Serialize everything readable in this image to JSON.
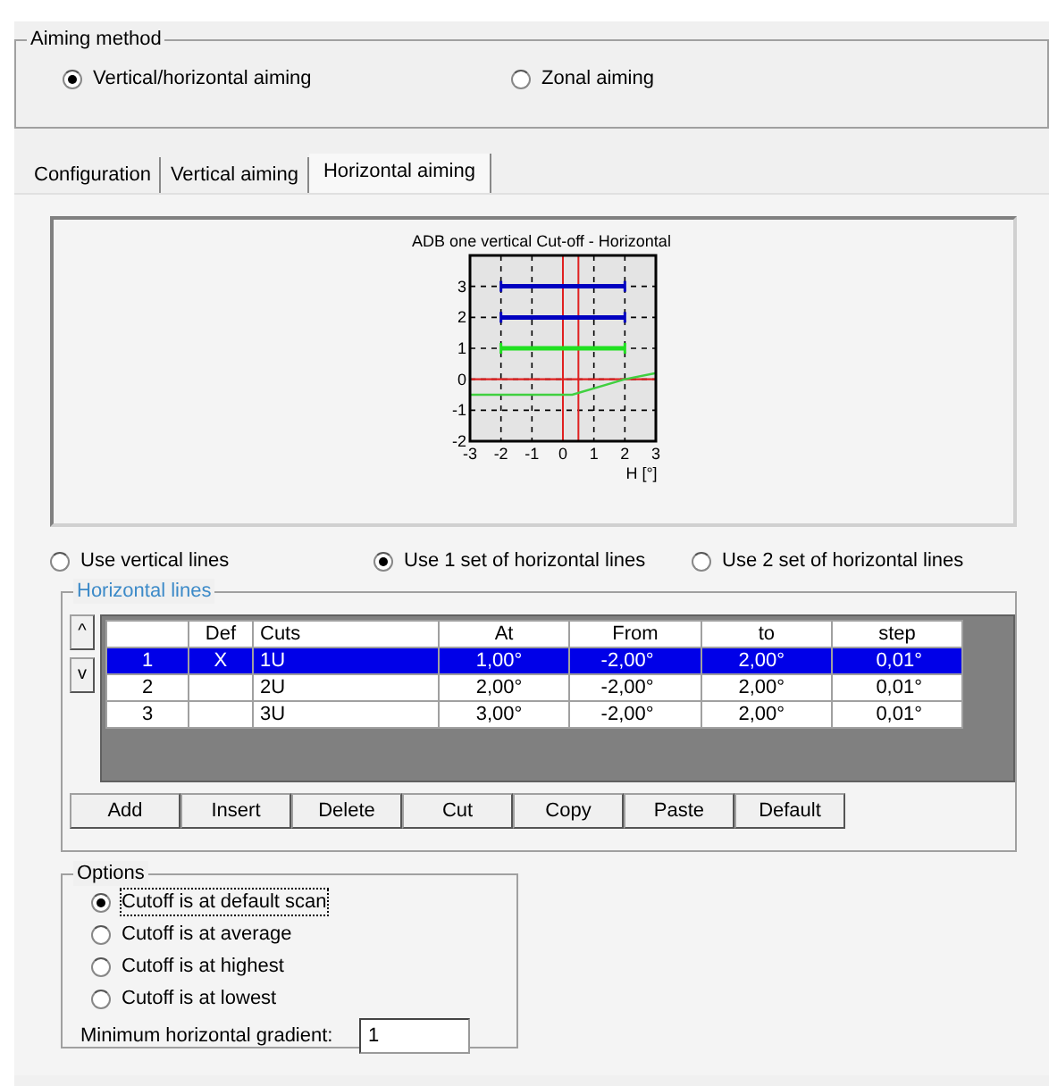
{
  "aiming_method": {
    "title": "Aiming method",
    "options": [
      {
        "label": "Vertical/horizontal aiming",
        "selected": true
      },
      {
        "label": "Zonal aiming",
        "selected": false
      }
    ]
  },
  "tabs": [
    {
      "label": "Configuration",
      "selected": false
    },
    {
      "label": "Vertical aiming",
      "selected": false
    },
    {
      "label": "Horizontal aiming",
      "selected": true
    }
  ],
  "chart": {
    "chart_data": {
      "type": "line",
      "title": "ADB one vertical Cut-off - Horizontal",
      "xlabel": "H [°]",
      "xlim": [
        -3,
        3
      ],
      "ylim": [
        -2,
        4
      ],
      "xticks": [
        -3,
        -2,
        -1,
        0,
        1,
        2,
        3
      ],
      "yticks": [
        -2,
        -1,
        0,
        1,
        2,
        3
      ],
      "x": [
        -3,
        -2,
        0.3,
        2,
        3
      ],
      "series": [
        {
          "color": "#0000c0",
          "values": [
            null,
            3,
            3,
            3,
            null
          ]
        },
        {
          "color": "#0000c0",
          "values": [
            null,
            2,
            2,
            2,
            null
          ]
        },
        {
          "color": "#20e020",
          "values": [
            null,
            1,
            1,
            1,
            null
          ]
        },
        {
          "color": "#e02020",
          "values": [
            0,
            0,
            0,
            0,
            0
          ]
        },
        {
          "color": "#40d040",
          "values": [
            -0.5,
            -0.5,
            -0.5,
            0,
            0.2
          ]
        }
      ],
      "grid": true,
      "ref_lines": [
        {
          "axis": "x",
          "value": 0,
          "color": "#e02020"
        },
        {
          "axis": "x",
          "value": 0.5,
          "color": "#e02020"
        }
      ]
    }
  },
  "line_mode": [
    {
      "label": "Use vertical lines",
      "selected": false
    },
    {
      "label": "Use 1 set of horizontal lines",
      "selected": true
    },
    {
      "label": "Use 2 set of horizontal lines",
      "selected": false
    }
  ],
  "horizontal_lines": {
    "title": "Horizontal lines",
    "scroll_buttons": [
      "^",
      "v"
    ],
    "columns": [
      "Def",
      "Cuts",
      "At",
      "From",
      "to",
      "step"
    ],
    "rows": [
      {
        "number": "1",
        "def": "X",
        "cuts": "1U",
        "at": "1,00°",
        "from": "-2,00°",
        "to": "2,00°",
        "step": "0,01°",
        "selected": true
      },
      {
        "number": "2",
        "cuts": "2U",
        "at": "2,00°",
        "from": "-2,00°",
        "to": "2,00°",
        "step": "0,01°",
        "selected": false
      },
      {
        "number": "3",
        "cuts": "3U",
        "at": "3,00°",
        "from": "-2,00°",
        "to": "2,00°",
        "step": "0,01°",
        "selected": false
      }
    ],
    "buttons": [
      "Add",
      "Insert",
      "Delete",
      "Cut",
      "Copy",
      "Paste",
      "Default"
    ]
  },
  "options": {
    "title": "Options",
    "choices": [
      {
        "label": "Cutoff is at default scan",
        "selected": true,
        "focused": true
      },
      {
        "label": "Cutoff is at average",
        "selected": false,
        "focused": false
      },
      {
        "label": "Cutoff is at highest",
        "selected": false,
        "focused": false
      },
      {
        "label": "Cutoff is at lowest",
        "selected": false,
        "focused": false
      }
    ],
    "gradient": {
      "label": "Minimum horizontal gradient:",
      "value": "1"
    }
  }
}
